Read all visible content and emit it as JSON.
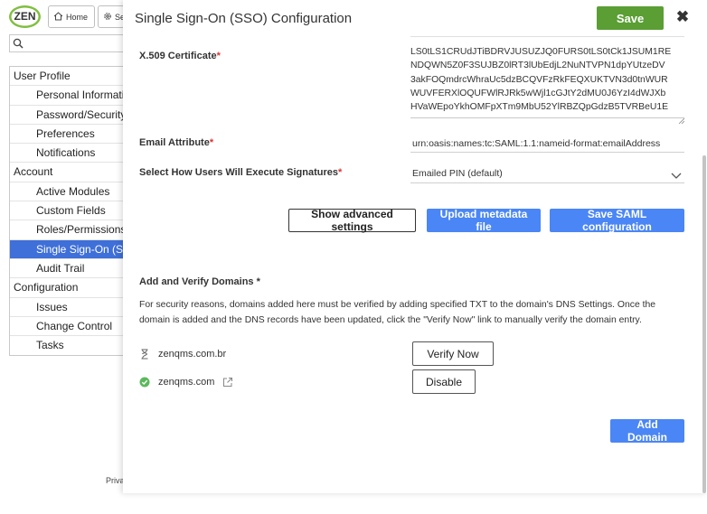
{
  "app": {
    "logo_text": "ZEN",
    "nav": {
      "home_label": "Home",
      "settings_label": "Se"
    },
    "search": {
      "placeholder": ""
    },
    "menu": [
      {
        "label": "User Profile",
        "level": 0
      },
      {
        "label": "Personal Information",
        "level": 1
      },
      {
        "label": "Password/Security",
        "level": 1
      },
      {
        "label": "Preferences",
        "level": 1
      },
      {
        "label": "Notifications",
        "level": 1
      },
      {
        "label": "Account",
        "level": 0
      },
      {
        "label": "Active Modules",
        "level": 1
      },
      {
        "label": "Custom Fields",
        "level": 1
      },
      {
        "label": "Roles/Permissions",
        "level": 1
      },
      {
        "label": "Single Sign-On (SSO)",
        "level": 1,
        "active": true
      },
      {
        "label": "Audit Trail",
        "level": 1
      },
      {
        "label": "Configuration",
        "level": 0
      },
      {
        "label": "Issues",
        "level": 1
      },
      {
        "label": "Change Control",
        "level": 1
      },
      {
        "label": "Tasks",
        "level": 1
      }
    ],
    "footer_privacy": "Priva"
  },
  "modal": {
    "title": "Single Sign-On (SSO) Configuration",
    "save_label": "Save",
    "close_symbol": "✖",
    "fields": {
      "certificate": {
        "label": "X.509 Certificate",
        "required_mark": "*",
        "lines": [
          "LS0tLS1CRUdJTiBDRVJUSUZJQ0FURS0tLS0tCk1JSUM1RE",
          "NDQWN5Z0F3SUJBZ0lRT3lUbEdjL2NuNTVPN1dpYUtzeDV",
          "3akFOQmdrcWhraUc5dzBCQVFzRkFEQXUKTVN3d0tnWUR",
          "WUVFERXlOQUFWlRJRk5wWjl1cGJtY2dMU0J6YzI4dWJXb",
          "HVaWEpoYkhOMFpXTm9MbU52YlRBZQpGdzB5TVRBeU1E"
        ]
      },
      "email": {
        "label": "Email Attribute",
        "required_mark": "*",
        "value": "urn:oasis:names:tc:SAML:1.1:nameid-format:emailAddress"
      },
      "signature": {
        "label": "Select How Users Will Execute Signatures",
        "required_mark": "*",
        "value": "Emailed PIN (default)"
      }
    },
    "actions": {
      "advanced_label": "Show advanced settings",
      "upload_label": "Upload metadata file",
      "save_saml_label": "Save SAML configuration"
    },
    "domains": {
      "title": "Add and Verify Domains *",
      "info": "For security reasons, domains added here must be verified by adding specified TXT to the domain's DNS Settings. Once the domain is added and the DNS records have been updated, click the \"Verify Now\" link to manually verify the domain entry.",
      "rows": [
        {
          "name": "zenqms.com.br",
          "status_icon": "hourglass-icon",
          "action_label": "Verify Now"
        },
        {
          "name": "zenqms.com",
          "status_icon": "check-circle-icon",
          "action_label": "Disable"
        }
      ],
      "add_label": "Add Domain"
    },
    "colors": {
      "save": "#5a9e34",
      "primary": "#4a86f5",
      "active_menu": "#3f6fd8",
      "verified": "#5cb85c"
    }
  }
}
